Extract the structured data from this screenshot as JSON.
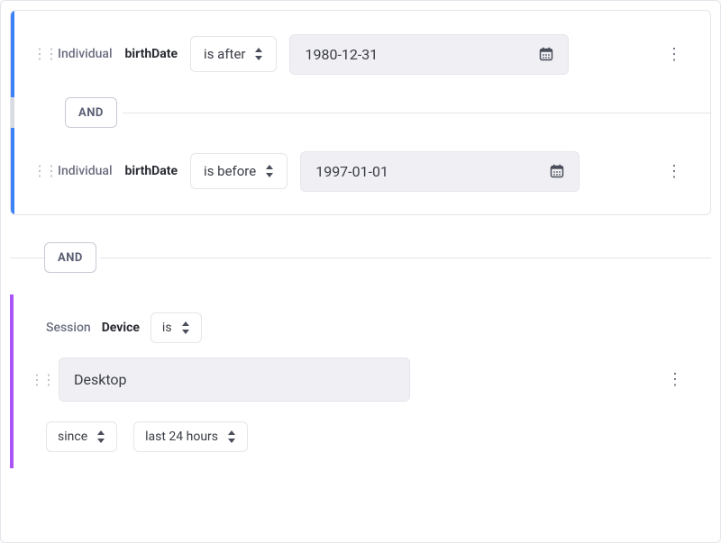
{
  "connectors": {
    "inner": "AND",
    "outer": "AND"
  },
  "group1": {
    "rules": [
      {
        "scope": "Individual",
        "field": "birthDate",
        "operator": "is after",
        "value": "1980-12-31"
      },
      {
        "scope": "Individual",
        "field": "birthDate",
        "operator": "is before",
        "value": "1997-01-01"
      }
    ]
  },
  "group2": {
    "scope": "Session",
    "field": "Device",
    "operator": "is",
    "value": "Desktop",
    "timeframe": {
      "mode": "since",
      "range": "last 24 hours"
    }
  }
}
